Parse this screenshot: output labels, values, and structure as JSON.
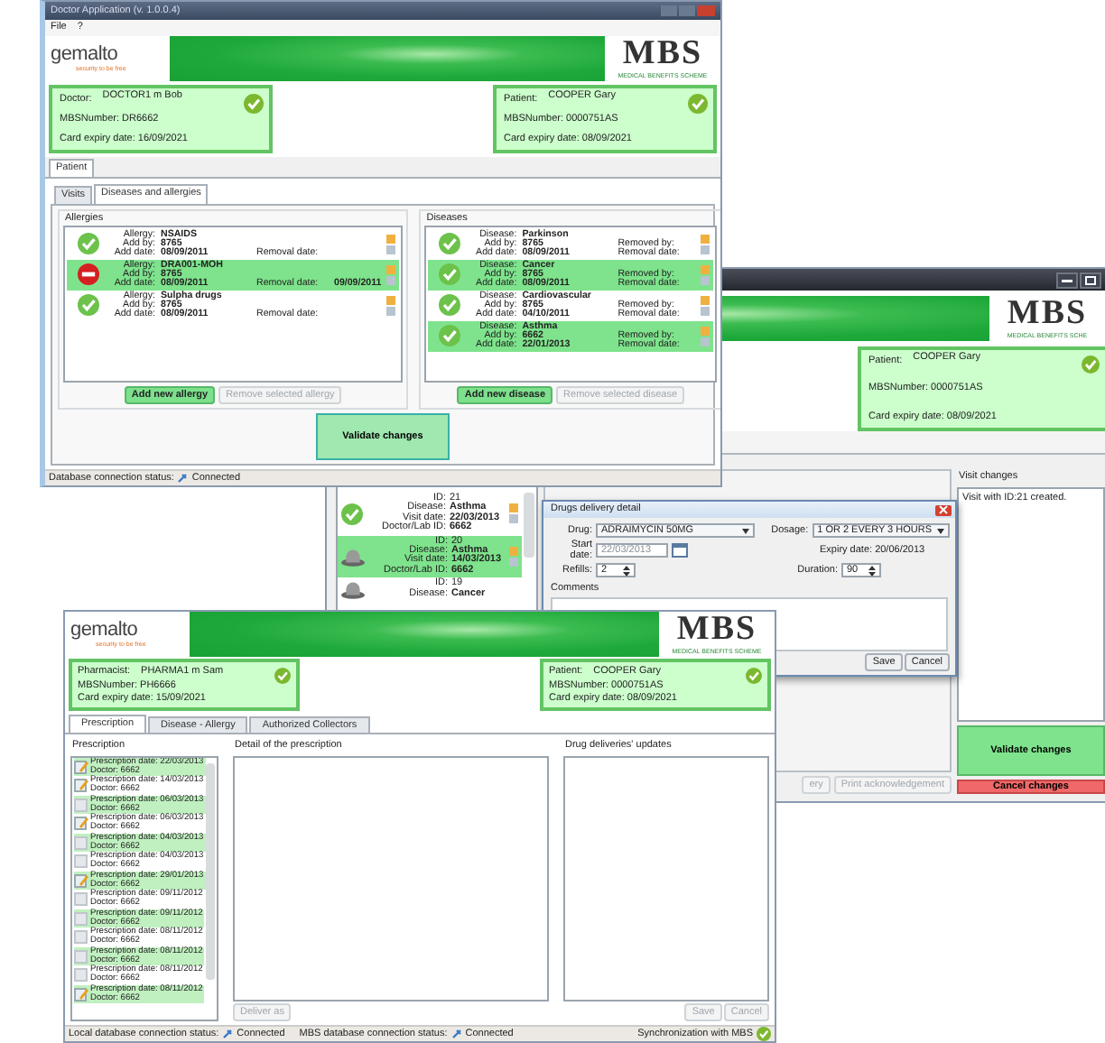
{
  "right_window": {
    "brand": {
      "mbs": "MBS",
      "mbs_subtitle": "MEDICAL BENEFITS SCHE"
    },
    "patient_card": {
      "role_label": "Patient:",
      "name": "COOPER Gary",
      "number": "MBSNumber: 0000751AS",
      "expiry": "Card expiry date: 08/09/2021"
    },
    "visits": [
      {
        "kind": "check",
        "selected": false,
        "id_label": "ID:",
        "id": "21",
        "disease_label": "Disease:",
        "disease": "Asthma",
        "date_label": "Visit date:",
        "date": "22/03/2013",
        "doctor_label": "Doctor/Lab ID:",
        "doctor": "6662"
      },
      {
        "kind": "hat",
        "selected": true,
        "id_label": "ID:",
        "id": "20",
        "disease_label": "Disease:",
        "disease": "Asthma",
        "date_label": "Visit date:",
        "date": "14/03/2013",
        "doctor_label": "Doctor/Lab ID:",
        "doctor": "6662"
      },
      {
        "kind": "hat",
        "selected": false,
        "id_label": "ID:",
        "id": "19",
        "disease_label": "Disease:",
        "disease": "Cancer"
      }
    ],
    "visit_changes": {
      "title": "Visit changes",
      "text": "Visit with ID:21 created."
    },
    "bottom_buttons": [
      {
        "label": "ery",
        "disabled": true
      },
      {
        "label": "Print acknowledgement",
        "disabled": true
      }
    ],
    "validate_button": "Validate changes",
    "cancel_button": "Cancel changes"
  },
  "dialog": {
    "title": "Drugs delivery detail",
    "drug_label": "Drug:",
    "drug": "ADRAIMYCIN 50MG",
    "dosage_label": "Dosage:",
    "dosage": "1 OR 2 EVERY 3 HOURS",
    "start_label": "Start date:",
    "start_date": "22/03/2013",
    "expiry": "Expiry date: 20/06/2013",
    "refills_label": "Refills:",
    "refills": "2",
    "duration_label": "Duration:",
    "duration": "90",
    "comments_label": "Comments",
    "buttons": [
      "Save",
      "Cancel"
    ]
  },
  "pharmacy_window": {
    "brand": {
      "gemalto": "gemalto",
      "tagline": "security to be free",
      "mbs": "MBS",
      "mbs_subtitle": "MEDICAL BENEFITS SCHEME"
    },
    "pharmacist_card": {
      "role_label": "Pharmacist:",
      "name": "PHARMA1 m Sam",
      "number": "MBSNumber: PH6666",
      "expiry": "Card expiry date: 15/09/2021"
    },
    "patient_card": {
      "role_label": "Patient:",
      "name": "COOPER Gary",
      "number": "MBSNumber: 0000751AS",
      "expiry": "Card expiry date: 08/09/2021"
    },
    "tabs": [
      {
        "label": "Prescription",
        "selected": true
      },
      {
        "label": "Disease - Allergy",
        "selected": false
      },
      {
        "label": "Authorized Collectors",
        "selected": false
      }
    ],
    "prescription_title": "Prescription",
    "prescriptions": [
      {
        "kind": "pen",
        "highlighted": true,
        "date": "Prescription date: 22/03/2013",
        "doctor": "Doctor: 6662"
      },
      {
        "kind": "pen",
        "highlighted": false,
        "date": "Prescription date: 14/03/2013",
        "doctor": "Doctor: 6662"
      },
      {
        "kind": "blank",
        "highlighted": true,
        "date": "Prescription date: 06/03/2013",
        "doctor": "Doctor: 6662"
      },
      {
        "kind": "pen",
        "highlighted": false,
        "date": "Prescription date: 06/03/2013",
        "doctor": "Doctor: 6662"
      },
      {
        "kind": "blank",
        "highlighted": true,
        "date": "Prescription date: 04/03/2013",
        "doctor": "Doctor: 6662"
      },
      {
        "kind": "blank",
        "highlighted": false,
        "date": "Prescription date: 04/03/2013",
        "doctor": "Doctor: 6662"
      },
      {
        "kind": "pen",
        "highlighted": true,
        "date": "Prescription date: 29/01/2013",
        "doctor": "Doctor: 6662"
      },
      {
        "kind": "blank",
        "highlighted": false,
        "date": "Prescription date: 09/11/2012",
        "doctor": "Doctor: 6662"
      },
      {
        "kind": "blank",
        "highlighted": true,
        "date": "Prescription date: 09/11/2012",
        "doctor": "Doctor: 6662"
      },
      {
        "kind": "blank",
        "highlighted": false,
        "date": "Prescription date: 08/11/2012",
        "doctor": "Doctor: 6662"
      },
      {
        "kind": "blank",
        "highlighted": true,
        "date": "Prescription date: 08/11/2012",
        "doctor": "Doctor: 6662"
      },
      {
        "kind": "blank",
        "highlighted": false,
        "date": "Prescription date: 08/11/2012",
        "doctor": "Doctor: 6662"
      },
      {
        "kind": "pen",
        "highlighted": true,
        "date": "Prescription date: 08/11/2012",
        "doctor": "Doctor: 6662"
      }
    ],
    "detail_title": "Detail of the prescription",
    "deliver_button": {
      "label": "Deliver as",
      "disabled": true
    },
    "updates_title": "Drug deliveries' updates",
    "buttons": [
      {
        "label": "Save",
        "disabled": true
      },
      {
        "label": "Cancel",
        "disabled": true
      }
    ],
    "status_bar": {
      "local_label": "Local database connection status:",
      "local_value": "Connected",
      "mbs_label": "MBS database connection status:",
      "mbs_value": "Connected",
      "sync_label": "Synchronization with MBS"
    }
  },
  "doctor_window": {
    "title": "Doctor Application (v. 1.0.0.4)",
    "menu": [
      "File",
      "?"
    ],
    "brand": {
      "gemalto": "gemalto",
      "tagline": "security to be free",
      "mbs": "MBS",
      "mbs_subtitle": "MEDICAL BENEFITS SCHEME"
    },
    "doctor_card": {
      "role_label": "Doctor:",
      "name": "DOCTOR1 m Bob",
      "number": "MBSNumber: DR6662",
      "expiry": "Card expiry date: 16/09/2021"
    },
    "patient_card": {
      "role_label": "Patient:",
      "name": "COOPER Gary",
      "number": "MBSNumber: 0000751AS",
      "expiry": "Card expiry date: 08/09/2021"
    },
    "tabs": [
      {
        "label": "Patient",
        "selected": true
      }
    ],
    "subtabs": [
      {
        "label": "Visits",
        "selected": false
      },
      {
        "label": "Diseases and allergies",
        "selected": true
      }
    ],
    "allergies": {
      "title": "Allergies",
      "items": [
        {
          "kind": "ok",
          "highlighted": false,
          "name_label": "Allergy:",
          "name": "NSAIDS",
          "add_by_label": "Add by:",
          "add_by": "8765",
          "add_date_label": "Add date:",
          "add_date": "08/09/2011",
          "removal_label": "Removal date:"
        },
        {
          "kind": "stop",
          "highlighted": true,
          "name_label": "Allergy:",
          "name": "DRA001-MOH",
          "add_by_label": "Add by:",
          "add_by": "8765",
          "add_date_label": "Add date:",
          "add_date": "08/09/2011",
          "removal_label": "Removal date:",
          "removal_date": "09/09/2011"
        },
        {
          "kind": "ok",
          "highlighted": false,
          "name_label": "Allergy:",
          "name": "Sulpha drugs",
          "add_by_label": "Add by:",
          "add_by": "8765",
          "add_date_label": "Add date:",
          "add_date": "08/09/2011",
          "removal_label": "Removal date:"
        }
      ],
      "buttons": [
        {
          "label": "Add new allergy",
          "disabled": false
        },
        {
          "label": "Remove selected allergy",
          "disabled": true
        }
      ]
    },
    "diseases": {
      "title": "Diseases",
      "items": [
        {
          "kind": "ok",
          "highlighted": false,
          "name_label": "Disease:",
          "name": "Parkinson",
          "add_by_label": "Add by:",
          "add_by": "8765",
          "removed_by_label": "Removed by:",
          "add_date_label": "Add date:",
          "add_date": "08/09/2011",
          "removal_label": "Removal date:"
        },
        {
          "kind": "ok",
          "highlighted": true,
          "name_label": "Disease:",
          "name": "Cancer",
          "add_by_label": "Add by:",
          "add_by": "8765",
          "removed_by_label": "Removed by:",
          "add_date_label": "Add date:",
          "add_date": "08/09/2011",
          "removal_label": "Removal date:"
        },
        {
          "kind": "ok",
          "highlighted": false,
          "name_label": "Disease:",
          "name": "Cardiovascular",
          "add_by_label": "Add by:",
          "add_by": "8765",
          "removed_by_label": "Removed by:",
          "add_date_label": "Add date:",
          "add_date": "04/10/2011",
          "removal_label": "Removal date:"
        },
        {
          "kind": "ok",
          "highlighted": true,
          "name_label": "Disease:",
          "name": "Asthma",
          "add_by_label": "Add by:",
          "add_by": "6662",
          "removed_by_label": "Removed by:",
          "add_date_label": "Add date:",
          "add_date": "22/01/2013",
          "removal_label": "Removal date:"
        }
      ],
      "buttons": [
        {
          "label": "Add new disease",
          "disabled": false
        },
        {
          "label": "Remove selected disease",
          "disabled": true
        }
      ]
    },
    "validate_button": "Validate changes",
    "status_bar": {
      "label": "Database connection status:",
      "value": "Connected"
    }
  }
}
